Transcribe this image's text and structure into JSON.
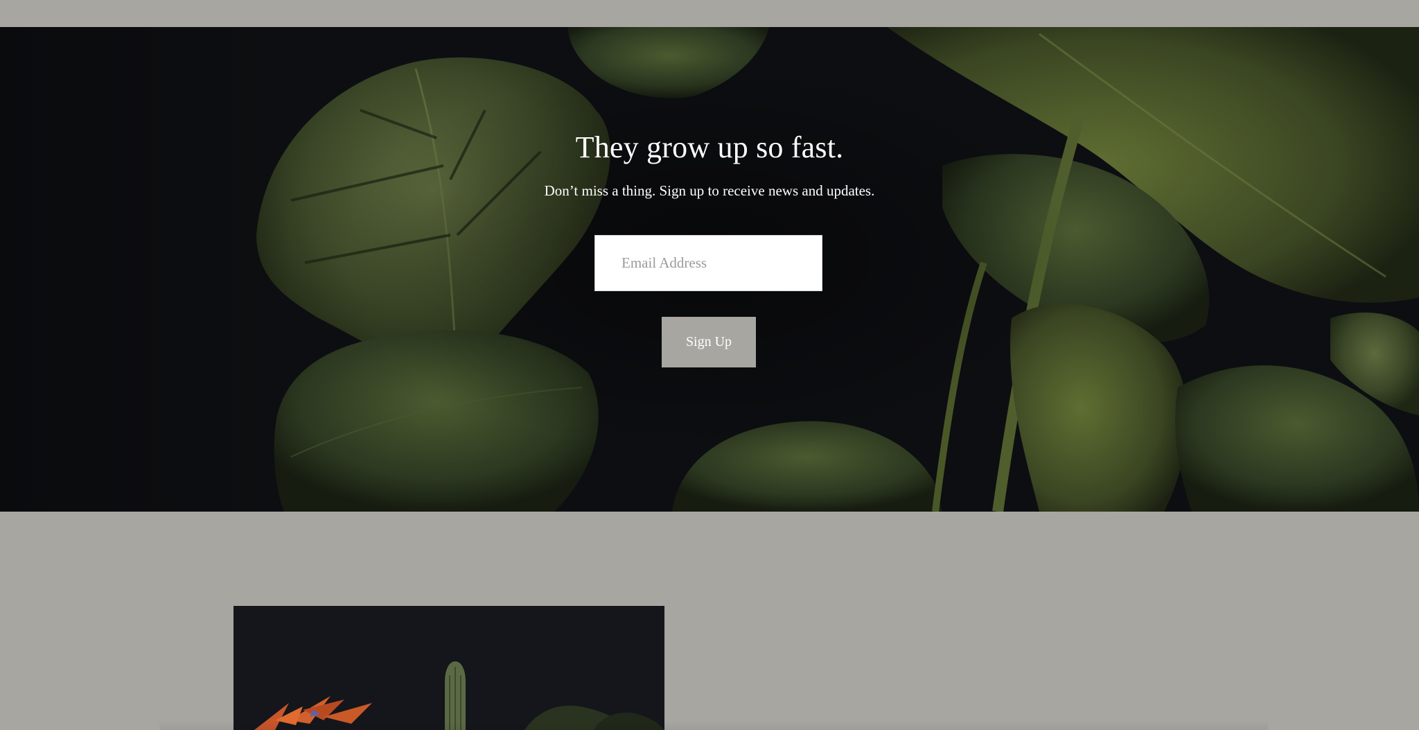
{
  "newsletter": {
    "title": "They grow up so fast.",
    "subtitle": "Don’t miss a thing. Sign up to receive news and updates.",
    "email_placeholder": "Email Address",
    "signup_label": "Sign Up"
  },
  "colors": {
    "page_background": "#a8a6a1",
    "hero_background": "#0c0d0f",
    "button_background": "#a8a6a1",
    "text_light": "#ffffff"
  },
  "images": {
    "hero": "monstera-leaves-photo",
    "product": "potted-plants-photo"
  }
}
